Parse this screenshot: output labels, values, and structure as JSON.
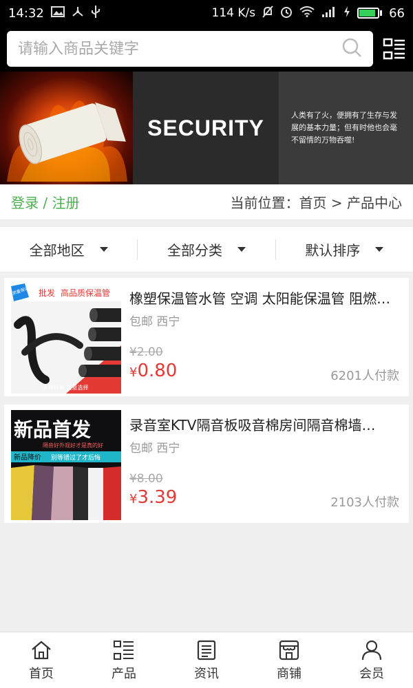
{
  "status_bar": {
    "time": "14:32",
    "speed": "114 K/s",
    "battery_level": "66",
    "battery_fraction": 0.9
  },
  "search": {
    "placeholder": "请输入商品关键字"
  },
  "banner": {
    "title": "SECURITY",
    "text": "人类有了火，便拥有了生存与发展的基本力量；但有时他也会毫不留情的万物吞噬!"
  },
  "location_bar": {
    "login": "登录",
    "separator": " / ",
    "register": "注册",
    "breadcrumb": "当前位置：首页 > 产品中心"
  },
  "filters": [
    {
      "label": "全部地区"
    },
    {
      "label": "全部分类"
    },
    {
      "label": "默认排序"
    }
  ],
  "products": [
    {
      "title": "橡塑保温管水管 空调 太阳能保温管 阻燃…",
      "location": "包邮 西宁",
      "old_price": "¥2.00",
      "currency": "¥",
      "price": "0.80",
      "paid": "6201人付款",
      "thumb_texts": {
        "tag": "批发",
        "headline": "高品质保温管",
        "badge": "质量保证",
        "footer": "多种规格 任意选择"
      }
    },
    {
      "title": "录音室KTV隔音板吸音棉房间隔音棉墙…",
      "location": "包邮 西宁",
      "old_price": "¥8.00",
      "currency": "¥",
      "price": "3.39",
      "paid": "2103人付款",
      "thumb_texts": {
        "headline": "新品首发",
        "subline": "隔音好外观好才是真的好",
        "tag": "新品降价",
        "tagline": "别等错过了才后悔"
      }
    }
  ],
  "bottom_nav": [
    {
      "label": "首页",
      "icon": "home-icon"
    },
    {
      "label": "产品",
      "icon": "list-icon"
    },
    {
      "label": "资讯",
      "icon": "news-icon"
    },
    {
      "label": "商铺",
      "icon": "store-icon"
    },
    {
      "label": "会员",
      "icon": "user-icon"
    }
  ]
}
